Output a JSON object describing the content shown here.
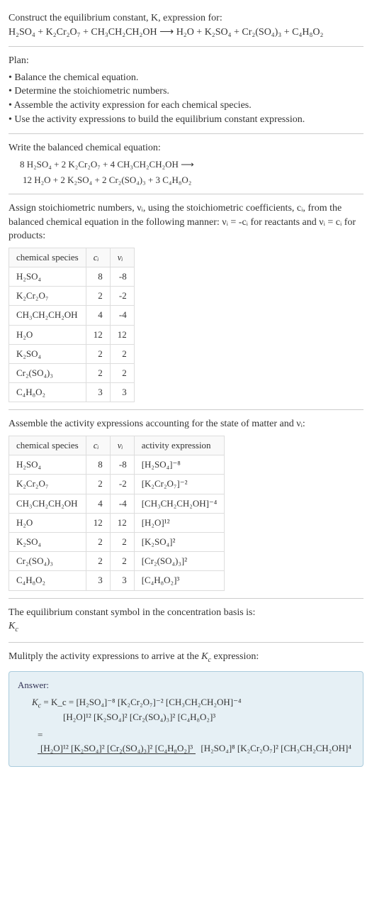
{
  "title_line1": "Construct the equilibrium constant, K, expression for:",
  "unbalanced_eq": "H₂SO₄ + K₂Cr₂O₇ + CH₃CH₂CH₂OH ⟶ H₂O + K₂SO₄ + Cr₂(SO₄)₃ + C₄H₈O₂",
  "plan_label": "Plan:",
  "plan_items": [
    "Balance the chemical equation.",
    "Determine the stoichiometric numbers.",
    "Assemble the activity expression for each chemical species.",
    "Use the activity expressions to build the equilibrium constant expression."
  ],
  "balanced_label": "Write the balanced chemical equation:",
  "balanced_eq_l1": "8 H₂SO₄ + 2 K₂Cr₂O₇ + 4 CH₃CH₂CH₂OH ⟶",
  "balanced_eq_l2": "12 H₂O + 2 K₂SO₄ + 2 Cr₂(SO₄)₃ + 3 C₄H₈O₂",
  "assign_text_a": "Assign stoichiometric numbers, νᵢ, using the stoichiometric coefficients, cᵢ, from the balanced chemical equation in the following manner: νᵢ = -cᵢ for reactants and νᵢ = cᵢ for products:",
  "table1": {
    "headers": [
      "chemical species",
      "cᵢ",
      "νᵢ"
    ],
    "rows": [
      {
        "sp": "H₂SO₄",
        "c": "8",
        "v": "-8"
      },
      {
        "sp": "K₂Cr₂O₇",
        "c": "2",
        "v": "-2"
      },
      {
        "sp": "CH₃CH₂CH₂OH",
        "c": "4",
        "v": "-4"
      },
      {
        "sp": "H₂O",
        "c": "12",
        "v": "12"
      },
      {
        "sp": "K₂SO₄",
        "c": "2",
        "v": "2"
      },
      {
        "sp": "Cr₂(SO₄)₃",
        "c": "2",
        "v": "2"
      },
      {
        "sp": "C₄H₈O₂",
        "c": "3",
        "v": "3"
      }
    ]
  },
  "assemble_text": "Assemble the activity expressions accounting for the state of matter and νᵢ:",
  "table2": {
    "headers": [
      "chemical species",
      "cᵢ",
      "νᵢ",
      "activity expression"
    ],
    "rows": [
      {
        "sp": "H₂SO₄",
        "c": "8",
        "v": "-8",
        "a": "[H₂SO₄]⁻⁸"
      },
      {
        "sp": "K₂Cr₂O₇",
        "c": "2",
        "v": "-2",
        "a": "[K₂Cr₂O₇]⁻²"
      },
      {
        "sp": "CH₃CH₂CH₂OH",
        "c": "4",
        "v": "-4",
        "a": "[CH₃CH₂CH₂OH]⁻⁴"
      },
      {
        "sp": "H₂O",
        "c": "12",
        "v": "12",
        "a": "[H₂O]¹²"
      },
      {
        "sp": "K₂SO₄",
        "c": "2",
        "v": "2",
        "a": "[K₂SO₄]²"
      },
      {
        "sp": "Cr₂(SO₄)₃",
        "c": "2",
        "v": "2",
        "a": "[Cr₂(SO₄)₃]²"
      },
      {
        "sp": "C₄H₈O₂",
        "c": "3",
        "v": "3",
        "a": "[C₄H₈O₂]³"
      }
    ]
  },
  "symbol_text": "The equilibrium constant symbol in the concentration basis is:",
  "symbol_val": "K_c",
  "multiply_text": "Mulitply the activity expressions to arrive at the K_c expression:",
  "answer_label": "Answer:",
  "kc_line1": "K_c = [H₂SO₄]⁻⁸ [K₂Cr₂O₇]⁻² [CH₃CH₂CH₂OH]⁻⁴",
  "kc_line2": "[H₂O]¹² [K₂SO₄]² [Cr₂(SO₄)₃]² [C₄H₈O₂]³",
  "frac_top": "[H₂O]¹² [K₂SO₄]² [Cr₂(SO₄)₃]² [C₄H₈O₂]³",
  "frac_bot": "[H₂SO₄]⁸ [K₂Cr₂O₇]² [CH₃CH₂CH₂OH]⁴",
  "chart_data": {
    "type": "table",
    "title": "Stoichiometric numbers and activity expressions",
    "tables": [
      {
        "columns": [
          "chemical species",
          "c_i",
          "nu_i"
        ],
        "rows": [
          [
            "H2SO4",
            8,
            -8
          ],
          [
            "K2Cr2O7",
            2,
            -2
          ],
          [
            "CH3CH2CH2OH",
            4,
            -4
          ],
          [
            "H2O",
            12,
            12
          ],
          [
            "K2SO4",
            2,
            2
          ],
          [
            "Cr2(SO4)3",
            2,
            2
          ],
          [
            "C4H8O2",
            3,
            3
          ]
        ]
      },
      {
        "columns": [
          "chemical species",
          "c_i",
          "nu_i",
          "activity expression"
        ],
        "rows": [
          [
            "H2SO4",
            8,
            -8,
            "[H2SO4]^-8"
          ],
          [
            "K2Cr2O7",
            2,
            -2,
            "[K2Cr2O7]^-2"
          ],
          [
            "CH3CH2CH2OH",
            4,
            -4,
            "[CH3CH2CH2OH]^-4"
          ],
          [
            "H2O",
            12,
            12,
            "[H2O]^12"
          ],
          [
            "K2SO4",
            2,
            2,
            "[K2SO4]^2"
          ],
          [
            "Cr2(SO4)3",
            2,
            2,
            "[Cr2(SO4)3]^2"
          ],
          [
            "C4H8O2",
            3,
            3,
            "[C4H8O2]^3"
          ]
        ]
      }
    ]
  }
}
